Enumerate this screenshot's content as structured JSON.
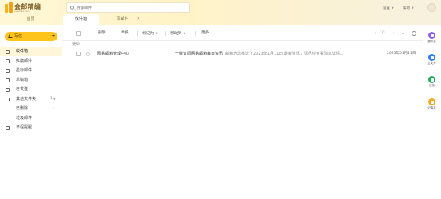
{
  "colors": {
    "brand": "#ffc41c",
    "header_bg": "#fff7d6",
    "active_nav_bg": "#fff6d9",
    "app_purple": "#8c5cf0",
    "app_blue": "#2f7cf6",
    "app_green": "#1aae5a",
    "app_orange": "#f5a623"
  },
  "header": {
    "logo_text": "会邮精编",
    "logo_sub": "yunmail.com",
    "search_placeholder": "搜索邮件",
    "help": "帮助",
    "settings": "设置"
  },
  "tabs": [
    {
      "label": "首页"
    },
    {
      "label": "收件箱"
    },
    {
      "label": "写邮件"
    }
  ],
  "sidebar": {
    "compose_label": "写信",
    "items": [
      {
        "label": "收件箱",
        "icon": "inbox-icon",
        "count": ""
      },
      {
        "label": "红旗邮件",
        "icon": "flag-icon",
        "count": ""
      },
      {
        "label": "星标邮件",
        "icon": "star-icon",
        "count": ""
      },
      {
        "label": "草稿箱",
        "icon": "draft-icon",
        "count": ""
      },
      {
        "label": "已发送",
        "icon": "sent-icon",
        "count": ""
      },
      {
        "label": "其他文件夹",
        "icon": "folder-icon",
        "count": "1"
      },
      {
        "label": "已删除",
        "icon": "trash-icon",
        "count": ""
      },
      {
        "label": "垃圾邮件",
        "icon": "spam-icon",
        "count": ""
      },
      {
        "label": "日程提醒",
        "icon": "calendar-icon",
        "count": ""
      }
    ]
  },
  "toolbar": {
    "delete": "删除",
    "report": "举报",
    "mark": "标记为",
    "move": "移动到",
    "more": "更多",
    "pager": "1/1"
  },
  "mail_list": {
    "group_label": "更早",
    "rows": [
      {
        "sender": "网易邮箱管理中心",
        "subject": "一键订阅网易邮箱每日资讯",
        "preview": "邮箱为您推送了2023年1月11日 最新资讯，请尽快查看消息详情...",
        "date": "2023年01月11日"
      }
    ]
  },
  "right_rail": {
    "apps": [
      {
        "label": "通讯录",
        "icon": "contacts-icon",
        "color": "#8c5cf0"
      },
      {
        "label": "云文件",
        "icon": "cloud-icon",
        "color": "#2f7cf6"
      },
      {
        "label": "日历",
        "icon": "calendar-app-icon",
        "color": "#1aae5a"
      },
      {
        "label": "记事本",
        "icon": "note-icon",
        "color": "#f5a623"
      }
    ]
  }
}
